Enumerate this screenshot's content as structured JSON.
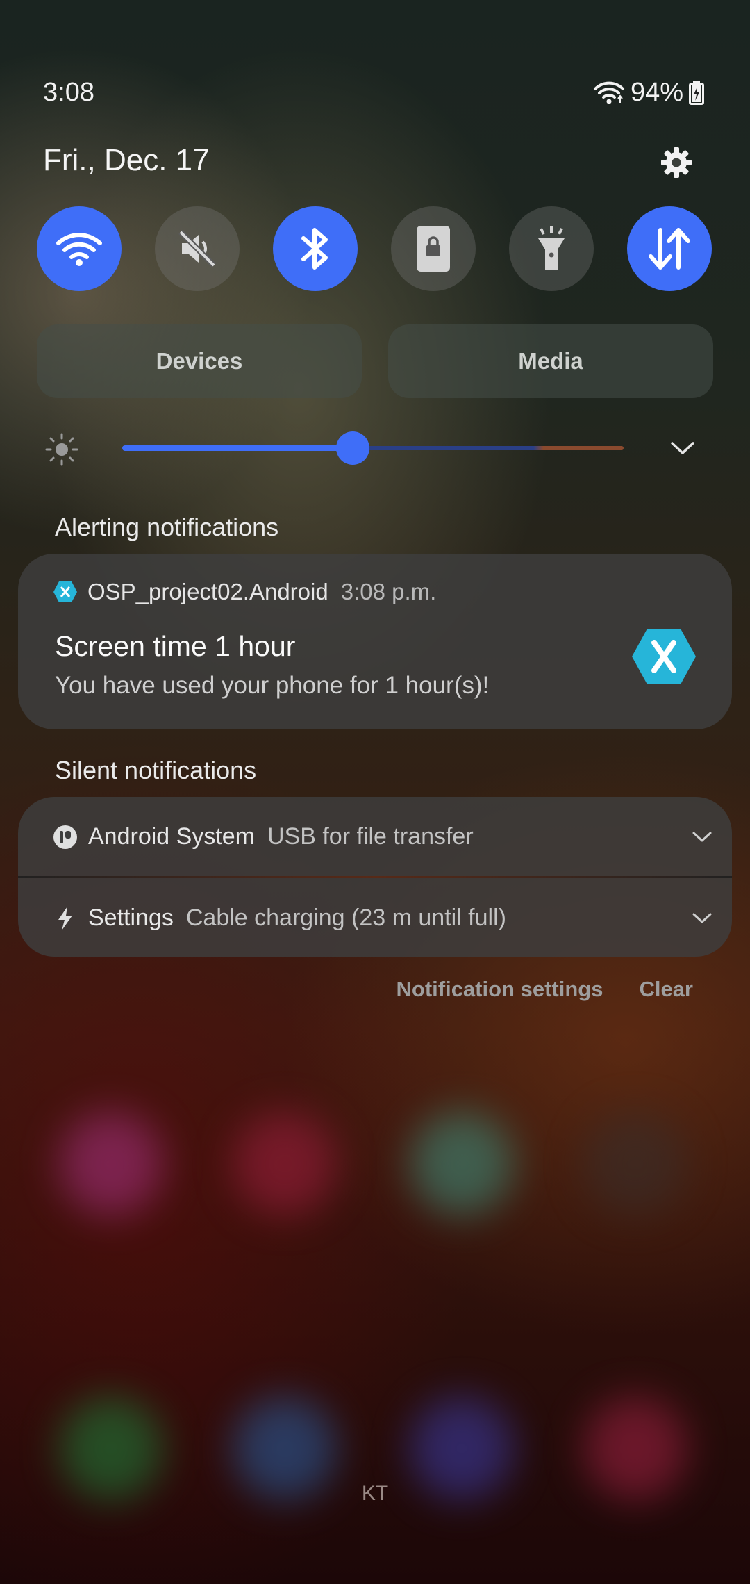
{
  "status_bar": {
    "time": "3:08",
    "battery": "94%"
  },
  "header": {
    "date": "Fri., Dec. 17",
    "settings_icon": "gear-icon"
  },
  "quick_toggles": [
    {
      "icon": "wifi-icon",
      "state": "on"
    },
    {
      "icon": "sound-muted-icon",
      "state": "off"
    },
    {
      "icon": "bluetooth-icon",
      "state": "on"
    },
    {
      "icon": "rotation-lock-icon",
      "state": "off"
    },
    {
      "icon": "flashlight-icon",
      "state": "off"
    },
    {
      "icon": "mobile-data-icon",
      "state": "on"
    }
  ],
  "panels": {
    "devices_label": "Devices",
    "media_label": "Media"
  },
  "brightness": {
    "level": 0.46
  },
  "alerting": {
    "section_title": "Alerting notifications",
    "app_name": "OSP_project02.Android",
    "time": "3:08 p.m.",
    "title": "Screen time 1 hour",
    "body": "You have used your phone for 1 hour(s)!"
  },
  "silent": {
    "section_title": "Silent notifications",
    "items": [
      {
        "app": "Android System",
        "text": "USB for file transfer"
      },
      {
        "app": "Settings",
        "text": "Cable charging (23 m until full)"
      }
    ]
  },
  "actions": {
    "notification_settings": "Notification settings",
    "clear": "Clear"
  },
  "carrier": "KT",
  "colors": {
    "accent": "#3f6ef8",
    "xamarin": "#26b5d9"
  }
}
